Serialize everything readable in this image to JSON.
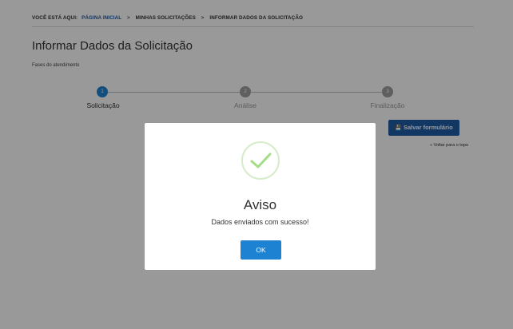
{
  "breadcrumb": {
    "prefix": "VOCÊ ESTÁ AQUI:",
    "items": [
      "PÁGINA INICIAL",
      "MINHAS SOLICITAÇÕES",
      "INFORMAR DADOS DA SOLICITAÇÃO"
    ],
    "separator": ">"
  },
  "page": {
    "title": "Informar Dados da Solicitação",
    "phases_label": "Fases do atendimento"
  },
  "steps": [
    {
      "number": "1",
      "label": "Solicitação",
      "state": "active"
    },
    {
      "number": "2",
      "label": "Análise",
      "state": "inactive"
    },
    {
      "number": "3",
      "label": "Finalização",
      "state": "inactive"
    }
  ],
  "actions": {
    "save_label": "Salvar formulário",
    "save_icon": "floppy-disk-icon",
    "back_to_top": "« Voltar para o topo"
  },
  "modal": {
    "icon": "checkmark-circle-icon",
    "title": "Aviso",
    "message": "Dados enviados com sucesso!",
    "ok_label": "OK"
  },
  "colors": {
    "primary": "#1e82d2",
    "save_button": "#1f5ca6",
    "success": "#a5dc86"
  }
}
